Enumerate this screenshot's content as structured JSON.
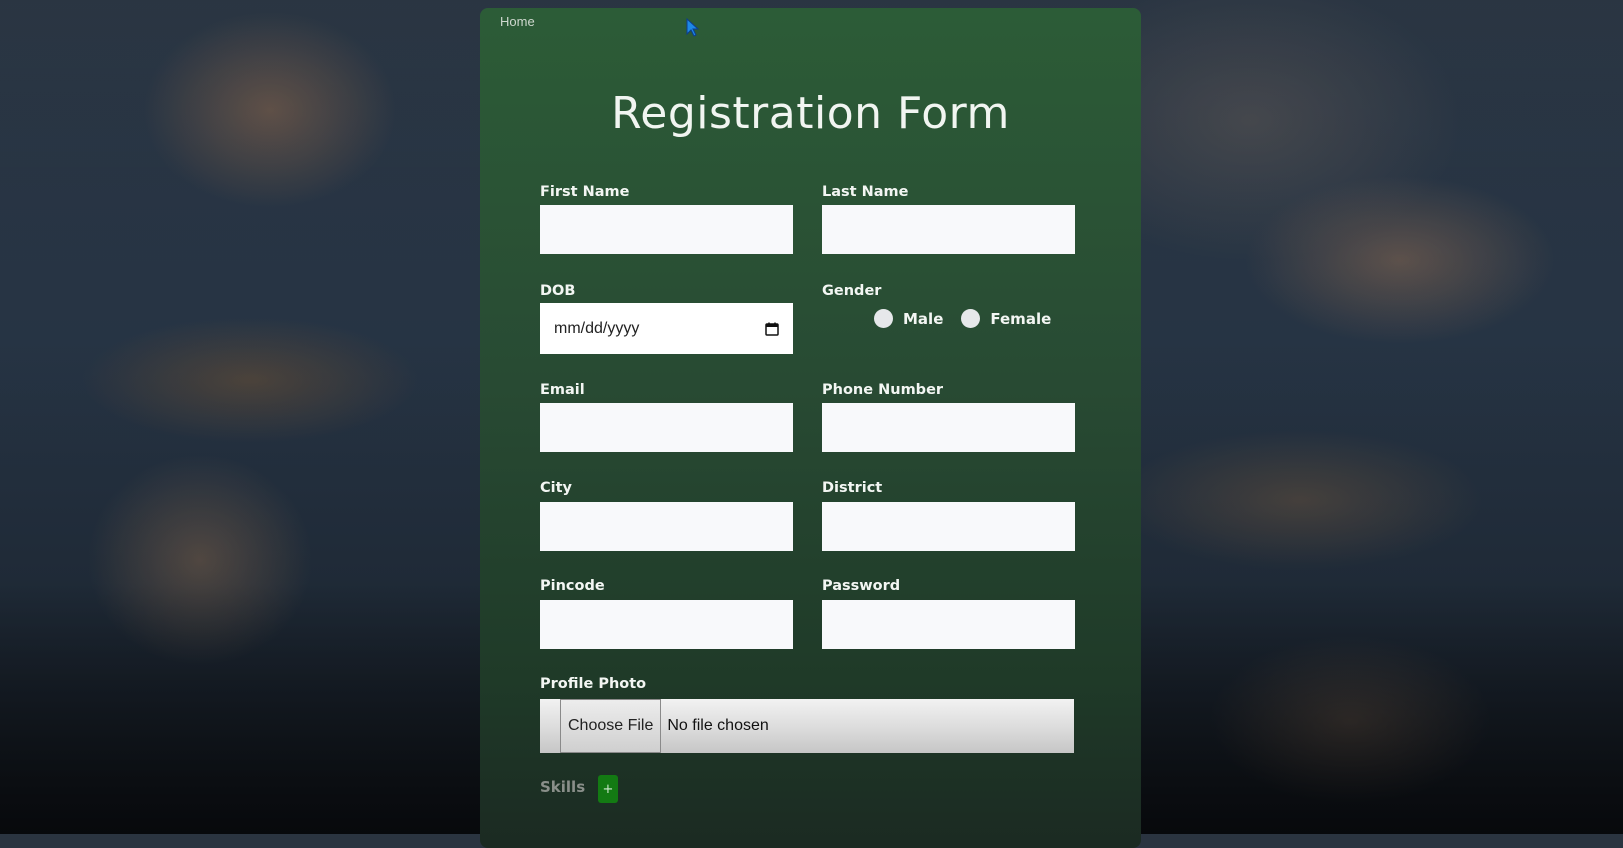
{
  "nav": {
    "home_label": "Home"
  },
  "form": {
    "title": "Registration Form",
    "fields": {
      "first_name": {
        "label": "First Name",
        "value": ""
      },
      "last_name": {
        "label": "Last Name",
        "value": ""
      },
      "dob": {
        "label": "DOB",
        "placeholder": "mm/dd/yyyy"
      },
      "gender": {
        "label": "Gender",
        "options": [
          "Male",
          "Female"
        ]
      },
      "email": {
        "label": "Email",
        "value": ""
      },
      "phone": {
        "label": "Phone Number",
        "value": ""
      },
      "city": {
        "label": "City",
        "value": ""
      },
      "district": {
        "label": "District",
        "value": ""
      },
      "pincode": {
        "label": "Pincode",
        "value": ""
      },
      "password": {
        "label": "Password",
        "value": ""
      },
      "profile_photo": {
        "label": "Profile Photo",
        "button": "Choose File",
        "status": "No file chosen"
      }
    },
    "skills": {
      "label": "Skills",
      "add_button": "+"
    }
  },
  "colors": {
    "card_top": "#2c5c37",
    "card_bottom": "#1b2a22",
    "add_button": "#137a13"
  },
  "icons": {
    "calendar": "calendar-icon",
    "cursor": "mouse-pointer-icon"
  }
}
